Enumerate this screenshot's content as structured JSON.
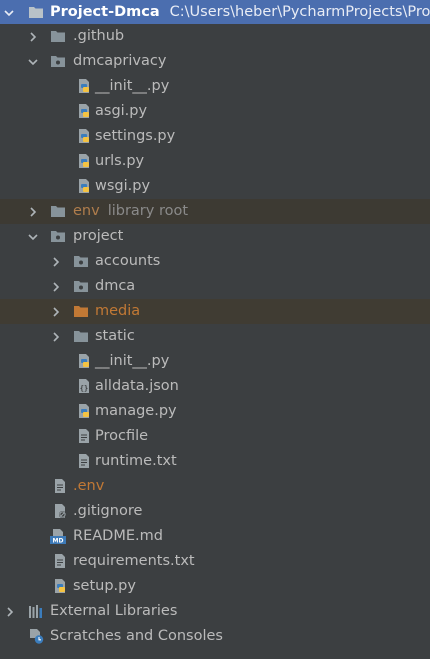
{
  "colors": {
    "background": "#3c3f41",
    "selection": "#4b6eaf",
    "folder": "#87939a",
    "folder_dark": "#6f7a80",
    "excluded_folder": "#c27935",
    "python_blue": "#3b7dbd",
    "python_yellow": "#f5c342",
    "text": "#bbbbbb",
    "muted_text": "#8a8a8a"
  },
  "tree": {
    "root": {
      "name": "Project-Dmca",
      "path": "C:\\Users\\heber\\PycharmProjects\\Project-Dmca",
      "icon": "folder-icon",
      "expanded": true
    },
    "github": {
      "name": ".github",
      "icon": "folder-icon",
      "expanded": false
    },
    "dmcaprivacy": {
      "name": "dmcaprivacy",
      "icon": "package-folder-icon",
      "expanded": true,
      "files": [
        {
          "name": "__init__.py",
          "icon": "python-file-icon"
        },
        {
          "name": "asgi.py",
          "icon": "python-file-icon"
        },
        {
          "name": "settings.py",
          "icon": "python-file-icon"
        },
        {
          "name": "urls.py",
          "icon": "python-file-icon"
        },
        {
          "name": "wsgi.py",
          "icon": "python-file-icon"
        }
      ]
    },
    "env": {
      "name": "env",
      "annotation": "library root",
      "icon": "folder-icon",
      "expanded": false
    },
    "project": {
      "name": "project",
      "icon": "package-folder-icon",
      "expanded": true,
      "accounts": {
        "name": "accounts",
        "icon": "package-folder-icon",
        "expanded": false
      },
      "dmca": {
        "name": "dmca",
        "icon": "package-folder-icon",
        "expanded": false
      },
      "media": {
        "name": "media",
        "icon": "excluded-folder-icon",
        "expanded": false
      },
      "static": {
        "name": "static",
        "icon": "folder-icon",
        "expanded": false
      },
      "files": [
        {
          "name": "__init__.py",
          "icon": "python-file-icon"
        },
        {
          "name": "alldata.json",
          "icon": "json-file-icon"
        },
        {
          "name": "manage.py",
          "icon": "python-file-icon"
        },
        {
          "name": "Procfile",
          "icon": "text-file-icon"
        },
        {
          "name": "runtime.txt",
          "icon": "text-file-icon"
        }
      ]
    },
    "root_files": [
      {
        "name": ".env",
        "icon": "text-file-icon"
      },
      {
        "name": ".gitignore",
        "icon": "ignore-file-icon"
      },
      {
        "name": "README.md",
        "icon": "markdown-file-icon"
      },
      {
        "name": "requirements.txt",
        "icon": "text-file-icon"
      },
      {
        "name": "setup.py",
        "icon": "python-file-icon"
      }
    ],
    "external_libraries": {
      "name": "External Libraries",
      "icon": "libraries-icon",
      "expanded": false
    },
    "scratches": {
      "name": "Scratches and Consoles",
      "icon": "scratches-icon"
    }
  }
}
